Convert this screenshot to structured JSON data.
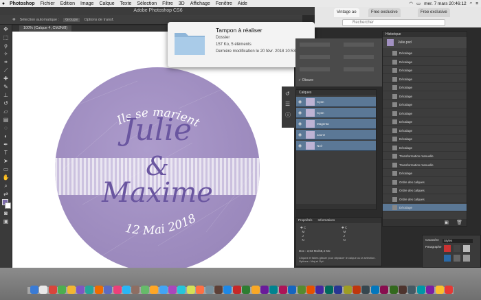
{
  "menubar": {
    "app": "Photoshop",
    "items": [
      "Fichier",
      "Edition",
      "Image",
      "Calque",
      "Texte",
      "Sélection",
      "Filtre",
      "3D",
      "Affichage",
      "Fenêtre",
      "Aide"
    ],
    "clock": "mer. 7 mars 20:46:12"
  },
  "photoshop": {
    "window_title": "Adobe Photoshop CS6",
    "options_label": "Sélection automatique :",
    "options_value": "Groupe",
    "options_transform": "Options de transf.",
    "doc_tab": "100% (Calque 4, CMJN/8)",
    "canvas": {
      "line1": "Ils se marient",
      "name1": "Julie",
      "ampersand": "&",
      "name2": "Maxime",
      "date": "12 Mai 2018"
    }
  },
  "finder_popup": {
    "title": "Tampon à réaliser",
    "kind": "Dossier",
    "size": "157 Ko, 5 éléments",
    "modified": "Dernière modification le 20 févr. 2018 10:53:35"
  },
  "browser": {
    "tabs": [
      "Vintage ao",
      "Free exclusive",
      "Free exclusive"
    ],
    "search_placeholder": "Rechercher"
  },
  "layers_panel": {
    "title": "Calques",
    "layers": [
      "Cyan",
      "Cyan",
      "Magenta",
      "Jaune",
      "Noir"
    ],
    "opacity_label": "Obsure"
  },
  "history_panel": {
    "title": "Historique",
    "snapshot": "Julie.psd",
    "entries": [
      "Décalage",
      "Décalage",
      "Décalage",
      "Décalage",
      "Décalage",
      "Décalage",
      "Décalage",
      "Décalage",
      "Décalage",
      "Décalage",
      "Décalage",
      "Décalage",
      "Transformation manuelle",
      "Transformation manuelle",
      "Décalage",
      "Ordre des calques",
      "Ordre des calques",
      "Ordre des calques",
      "Décalage"
    ]
  },
  "info_panel": {
    "tabs": [
      "Propriétés",
      "Informations"
    ],
    "doc": "Doc : 3,03 Mo/58,4 Mo",
    "hint": "Cliquez et faites glisser pour déplacer le calque ou la sélection. Options : Maj et Opt."
  },
  "styles_panel": {
    "title": "Styles",
    "sub": "Caractère",
    "sub2": "Paragraphe"
  },
  "colors": {
    "seal": "#a291c2",
    "text": "#6a56a0",
    "selection": "#5b7896"
  }
}
